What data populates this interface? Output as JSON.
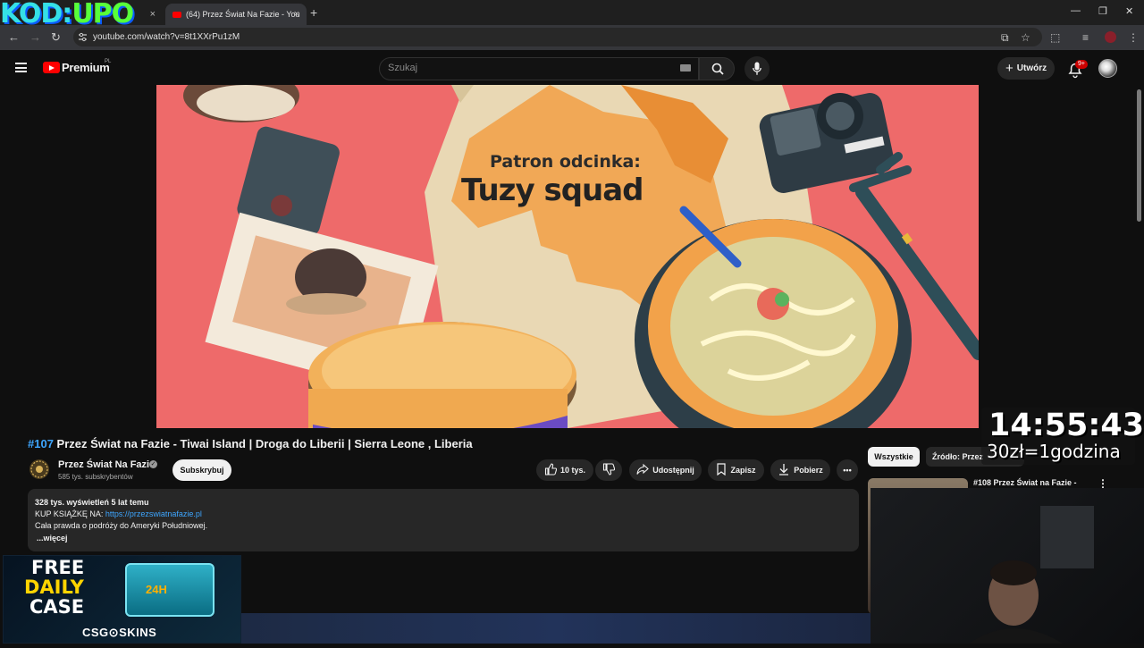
{
  "overlay_logo": {
    "part1": "KOD:",
    "part2": "UPO"
  },
  "browser": {
    "tabs": [
      {
        "label": "",
        "close": "×"
      },
      {
        "label": "(64) Przez Świat Na Fazie - You",
        "close": "×"
      }
    ],
    "new_tab": "+",
    "url": "youtube.com/watch?v=8t1XXrPu1zM",
    "window_controls": {
      "minimize": "—",
      "restore": "❐",
      "close": "✕"
    }
  },
  "youtube_header": {
    "brand": "Premium",
    "region": "PL",
    "search_placeholder": "Szukaj",
    "create_label": "Utwórz",
    "create_plus": "+",
    "notifications_badge": "9+"
  },
  "video_frame": {
    "patron_label": "Patron odcinka:",
    "patron_name": "Tuzy squad",
    "colors": {
      "background": "#ee6a6a",
      "map": "#e9d8b4"
    }
  },
  "video_info": {
    "number": "#107",
    "title": "Przez Świat na Fazie - Tiwai Island | Droga do Liberii | Sierra Leone , Liberia",
    "channel_name": "Przez Świat Na Fazie",
    "subscribers": "585 tys. subskrybentów",
    "subscribe_label": "Subskrybuj",
    "likes": "10 tys.",
    "share_label": "Udostępnij",
    "save_label": "Zapisz",
    "download_label": "Pobierz",
    "more_label": "•••"
  },
  "description": {
    "stats": "328 tys. wyświetleń  5 lat temu",
    "buy_prefix": "KUP KSIĄŻKĘ NA: ",
    "buy_link": "https://przezswiatnafazie.pl",
    "line2": "Cała prawda o podróży do Ameryki Południowej.",
    "more": "...więcej"
  },
  "sidebar": {
    "chips": [
      {
        "label": "Wszystkie",
        "active": true
      },
      {
        "label": "Źródło: Przez",
        "active": false
      }
    ],
    "recommendation": {
      "title": "#108 Przez Świat na Fazie -",
      "menu": "⋮"
    }
  },
  "stream_overlay": {
    "clock": "14:55:43",
    "rate": "30zł=1godzina"
  },
  "ad_banner": {
    "line1": "FREE",
    "line2": "DAILY",
    "line3": "CASE",
    "chest_text": "24H",
    "brand": "CSG⊙SKINS",
    "accent": "#ffd400"
  },
  "colors": {
    "accent_link": "#3ea6ff",
    "youtube_red": "#ff0000",
    "page_bg": "#0f0f0f"
  }
}
